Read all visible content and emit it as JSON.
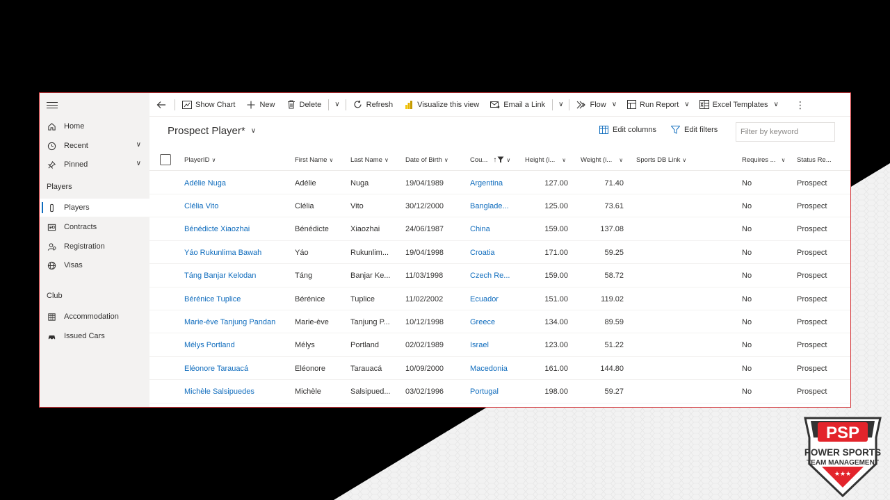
{
  "sidebar": {
    "home": "Home",
    "recent": "Recent",
    "pinned": "Pinned",
    "players_section": "Players",
    "club_section": "Club",
    "items": [
      {
        "label": "Players",
        "icon": "player-icon"
      },
      {
        "label": "Contracts",
        "icon": "contract-icon"
      },
      {
        "label": "Registration",
        "icon": "registration-icon"
      },
      {
        "label": "Visas",
        "icon": "globe-icon"
      },
      {
        "label": "Accommodation",
        "icon": "building-icon"
      },
      {
        "label": "Issued Cars",
        "icon": "car-icon"
      }
    ]
  },
  "toolbar": {
    "show_chart": "Show Chart",
    "new": "New",
    "delete": "Delete",
    "refresh": "Refresh",
    "visualize": "Visualize this view",
    "email_link": "Email a Link",
    "flow": "Flow",
    "run_report": "Run Report",
    "excel_templates": "Excel Templates"
  },
  "view": {
    "title": "Prospect Player*",
    "edit_columns": "Edit columns",
    "edit_filters": "Edit filters",
    "filter_placeholder": "Filter by keyword"
  },
  "grid": {
    "columns": {
      "player_id": "PlayerID",
      "first_name": "First Name",
      "last_name": "Last Name",
      "dob": "Date of Birth",
      "country": "Cou...",
      "height": "Height (i...",
      "weight": "Weight (i...",
      "sports_db": "Sports DB Link",
      "requires": "Requires ...",
      "status": "Status Re..."
    },
    "rows": [
      {
        "player_id": "Adélie Nuga",
        "first": "Adélie",
        "last": "Nuga",
        "dob": "19/04/1989",
        "country": "Argentina",
        "height": "127.00",
        "weight": "71.40",
        "requires": "No",
        "status": "Prospect"
      },
      {
        "player_id": "Clélia Vito",
        "first": "Clélia",
        "last": "Vito",
        "dob": "30/12/2000",
        "country": "Banglade...",
        "height": "125.00",
        "weight": "73.61",
        "requires": "No",
        "status": "Prospect"
      },
      {
        "player_id": "Bénédicte Xiaozhai",
        "first": "Bénédicte",
        "last": "Xiaozhai",
        "dob": "24/06/1987",
        "country": "China",
        "height": "159.00",
        "weight": "137.08",
        "requires": "No",
        "status": "Prospect"
      },
      {
        "player_id": "Yáo Rukunlima Bawah",
        "first": "Yáo",
        "last": "Rukunlim...",
        "dob": "19/04/1998",
        "country": "Croatia",
        "height": "171.00",
        "weight": "59.25",
        "requires": "No",
        "status": "Prospect"
      },
      {
        "player_id": "Táng Banjar Kelodan",
        "first": "Táng",
        "last": "Banjar Ke...",
        "dob": "11/03/1998",
        "country": "Czech Re...",
        "height": "159.00",
        "weight": "58.72",
        "requires": "No",
        "status": "Prospect"
      },
      {
        "player_id": "Bérénice Tuplice",
        "first": "Bérénice",
        "last": "Tuplice",
        "dob": "11/02/2002",
        "country": "Ecuador",
        "height": "151.00",
        "weight": "119.02",
        "requires": "No",
        "status": "Prospect"
      },
      {
        "player_id": "Marie-ève Tanjung Pandan",
        "first": "Marie-ève",
        "last": "Tanjung P...",
        "dob": "10/12/1998",
        "country": "Greece",
        "height": "134.00",
        "weight": "89.59",
        "requires": "No",
        "status": "Prospect"
      },
      {
        "player_id": "Mélys Portland",
        "first": "Mélys",
        "last": "Portland",
        "dob": "02/02/1989",
        "country": "Israel",
        "height": "123.00",
        "weight": "51.22",
        "requires": "No",
        "status": "Prospect"
      },
      {
        "player_id": "Eléonore Tarauacá",
        "first": "Eléonore",
        "last": "Tarauacá",
        "dob": "10/09/2000",
        "country": "Macedonia",
        "height": "161.00",
        "weight": "144.80",
        "requires": "No",
        "status": "Prospect"
      },
      {
        "player_id": "Michèle Salsipuedes",
        "first": "Michèle",
        "last": "Salsipued...",
        "dob": "03/02/1996",
        "country": "Portugal",
        "height": "198.00",
        "weight": "59.27",
        "requires": "No",
        "status": "Prospect"
      }
    ]
  },
  "logo": {
    "abbr": "PSP",
    "line1": "POWER SPORTS",
    "line2": "TEAM MANAGEMENT",
    "brand_red": "#e3242b"
  },
  "colors": {
    "link": "#0f6cbd",
    "frame_border": "#d13438"
  }
}
